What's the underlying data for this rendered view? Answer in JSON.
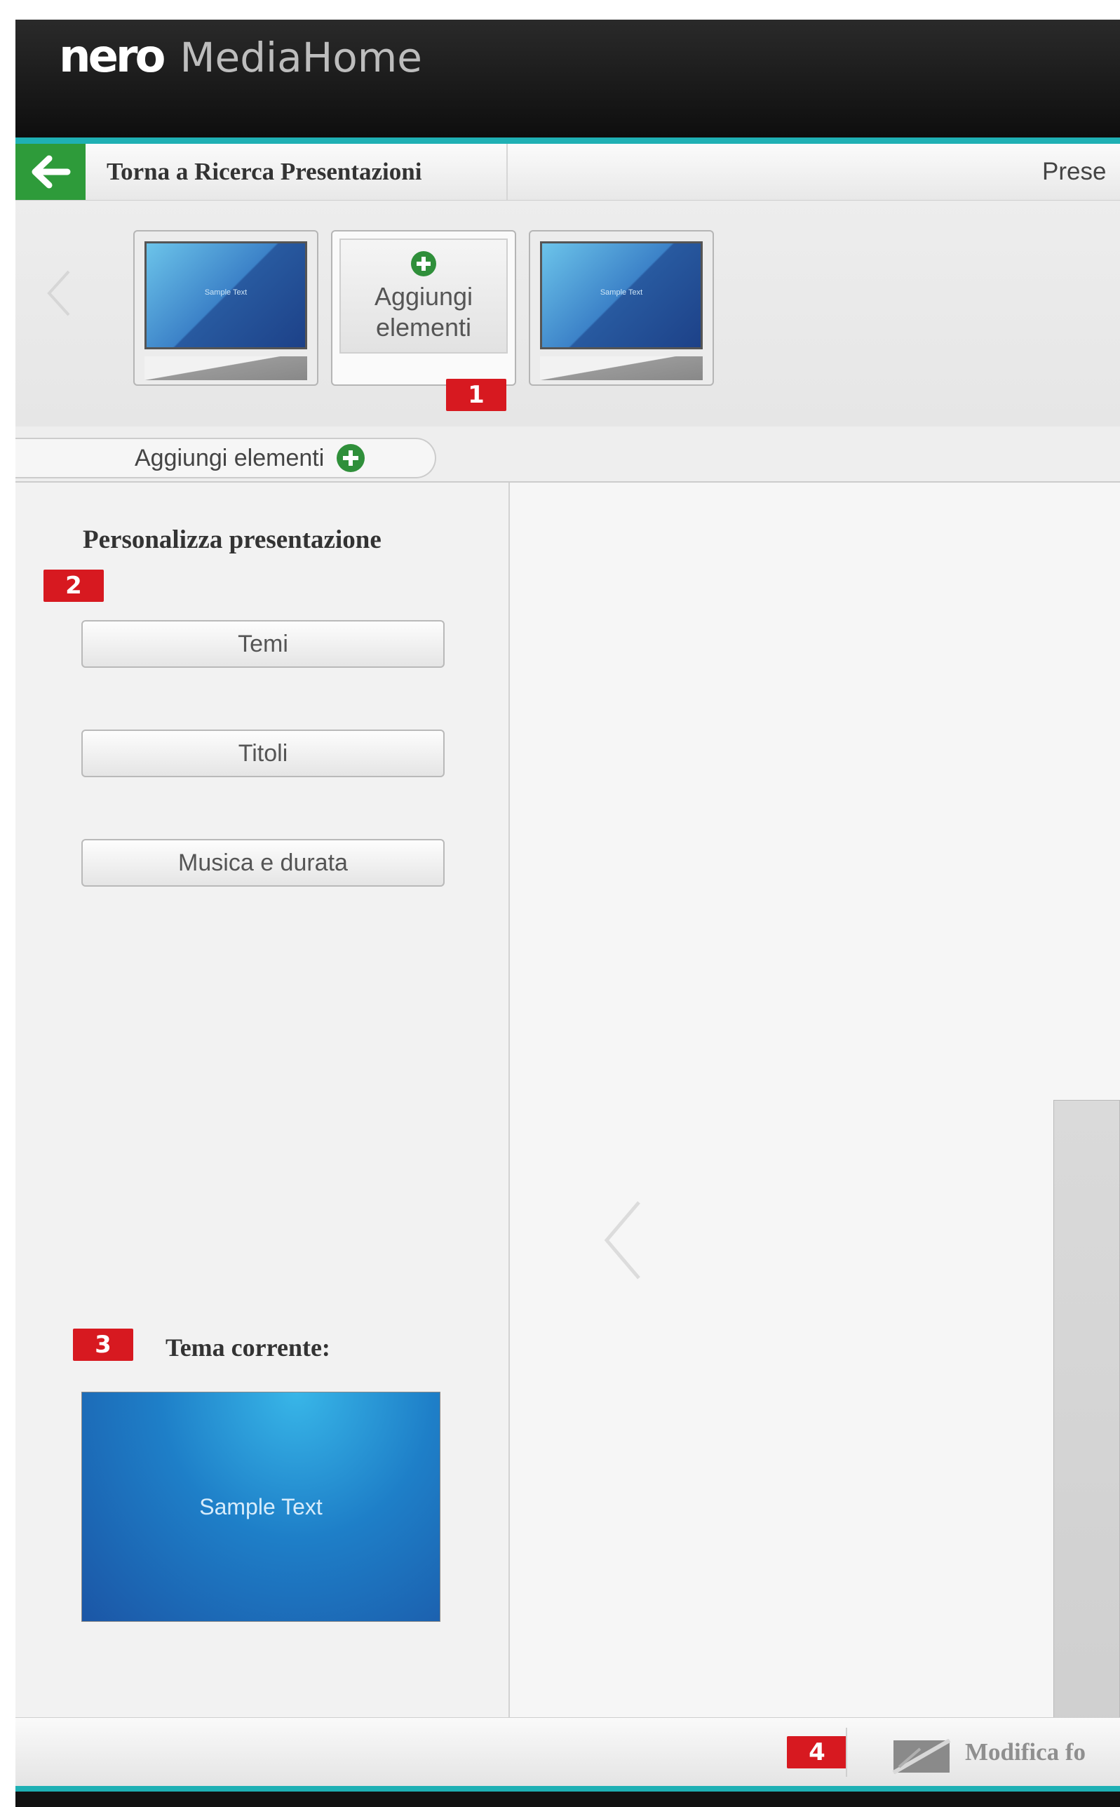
{
  "app": {
    "brand_nero": "nero",
    "brand_product": "MediaHome"
  },
  "nav": {
    "back_label": "Torna a Ricerca Presentazioni",
    "right_label": "Prese"
  },
  "strip": {
    "items": [
      {
        "type": "slide",
        "caption": "Sample Text"
      },
      {
        "type": "add",
        "label": "Aggiungi elementi"
      },
      {
        "type": "slide",
        "caption": "Sample Text"
      }
    ]
  },
  "tab": {
    "add_label": "Aggiungi elementi"
  },
  "sidebar": {
    "title": "Personalizza presentazione",
    "buttons": [
      "Temi",
      "Titoli",
      "Musica e durata"
    ],
    "current_theme_label": "Tema corrente:",
    "current_theme_text": "Sample Text"
  },
  "callouts": [
    "1",
    "2",
    "3",
    "4"
  ],
  "bottom": {
    "edit_label": "Modifica fo"
  },
  "colors": {
    "accent_teal": "#1fb0b4",
    "back_green": "#2e9b3a",
    "badge_red": "#d71920",
    "plus_green": "#2f8f3a"
  },
  "icons": [
    "back-arrow-icon",
    "add-plus-icon",
    "left-arrow-icon",
    "edit-photo-icon"
  ]
}
